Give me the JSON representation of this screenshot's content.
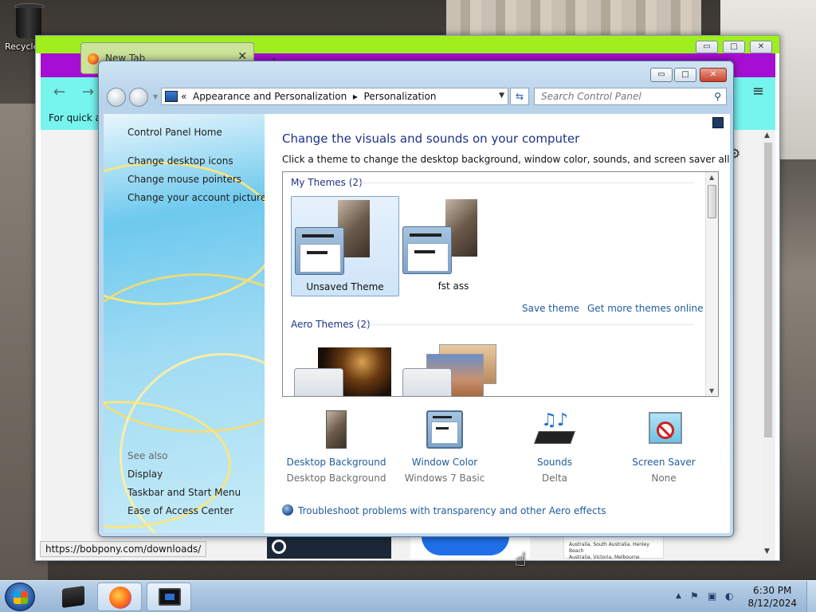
{
  "desktop": {
    "icons": [
      {
        "label": "Recycle Bin",
        "icon": "recycle-bin-icon"
      }
    ]
  },
  "firefox": {
    "tab": {
      "title": "New Tab",
      "close": "✕"
    },
    "new_tab_symbol": "+",
    "tabs_dropdown_symbol": "⌄",
    "window_buttons": {
      "minimize": "▭",
      "maximize": "□",
      "close": "✕"
    },
    "nav": {
      "back": "←",
      "forward": "→"
    },
    "menu_symbol": "≡",
    "bookmarks_text": "For quick ac",
    "status_url": "https://bobpony.com/downloads/",
    "thumb_list_lines": [
      "Australia, South Australia, Henley Beach",
      "Australia, Victoria, Melbourne"
    ]
  },
  "control_panel": {
    "window_buttons": {
      "minimize": "▭",
      "maximize": "□",
      "close": "✕"
    },
    "address": {
      "chevrons": "«",
      "crumb_1": "Appearance and Personalization",
      "separator": "▸",
      "crumb_2": "Personalization"
    },
    "search_placeholder": "Search Control Panel",
    "sidebar": {
      "home": "Control Panel Home",
      "links": [
        "Change desktop icons",
        "Change mouse pointers",
        "Change your account picture"
      ],
      "see_also_label": "See also",
      "see_also_links": [
        "Display",
        "Taskbar and Start Menu",
        "Ease of Access Center"
      ]
    },
    "heading": "Change the visuals and sounds on your computer",
    "description": "Click a theme to change the desktop background, window color, sounds, and screen saver all at once.",
    "my_themes": {
      "label": "My Themes (2)",
      "items": [
        {
          "name": "Unsaved Theme",
          "selected": true
        },
        {
          "name": "fst ass",
          "selected": false
        }
      ],
      "save_link": "Save theme",
      "more_link": "Get more themes online"
    },
    "aero_themes": {
      "label": "Aero Themes (2)"
    },
    "settings": [
      {
        "title": "Desktop Background",
        "value": "Desktop Background",
        "icon": "desktop-background-icon"
      },
      {
        "title": "Window Color",
        "value": "Windows 7 Basic",
        "icon": "window-color-icon"
      },
      {
        "title": "Sounds",
        "value": "Delta",
        "icon": "sounds-icon"
      },
      {
        "title": "Screen Saver",
        "value": "None",
        "icon": "screen-saver-icon"
      }
    ],
    "troubleshoot_link": "Troubleshoot problems with transparency and other Aero effects"
  },
  "taskbar": {
    "tray_arrow": "▲",
    "time": "6:30 PM",
    "date": "8/12/2024"
  },
  "colors": {
    "ff_titlebar": "#9fef1f",
    "ff_tabbar": "#a60fd3",
    "ff_navbar": "#75f5ee",
    "link_blue": "#1e5c9e",
    "heading_blue": "#1e3287"
  }
}
